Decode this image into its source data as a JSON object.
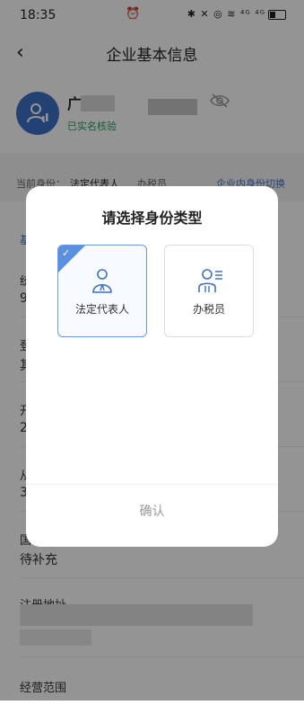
{
  "statusbar": {
    "time": "18:35",
    "icons": "✱ ✕ ◎ ≋ ⁴ᴳ ⁴ᴳ"
  },
  "nav": {
    "title": "企业基本信息",
    "back_glyph": "‹"
  },
  "profile": {
    "name": "广西锦",
    "verified": "已实名核验"
  },
  "identity": {
    "label": "当前身份：",
    "legal": "法定代表人",
    "tax": "办税员",
    "switch": "企业内身份切换"
  },
  "content": {
    "section": "基",
    "rows": [
      {
        "label": "统",
        "value": "9"
      },
      {
        "label": "登",
        "value": "其"
      },
      {
        "label": "开",
        "value": "2"
      },
      {
        "label": "从",
        "value": "3"
      }
    ],
    "nationality_label": "国",
    "nationality_value": "待补充",
    "address_label": "注册地址",
    "scope_label": "经营范围"
  },
  "dialog": {
    "title": "请选择身份类型",
    "options": [
      {
        "label": "法定代表人",
        "selected": true
      },
      {
        "label": "办税员",
        "selected": false
      }
    ],
    "confirm": "确认"
  },
  "colors": {
    "accent": "#3d72c6",
    "verified": "#2a9d5c"
  }
}
